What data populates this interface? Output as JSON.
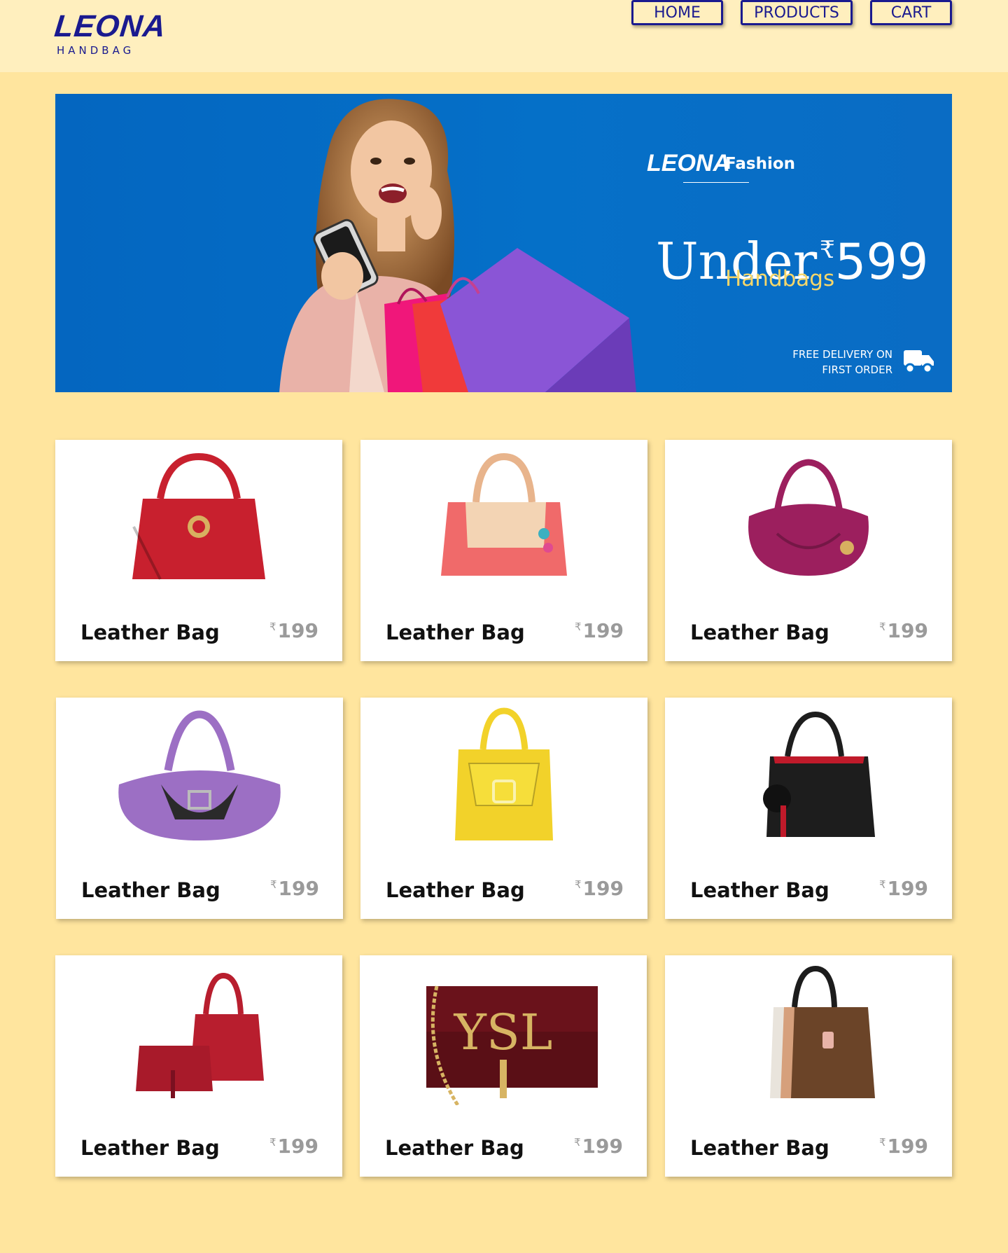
{
  "brand": {
    "name": "LEONA",
    "subtitle": "HANDBAG"
  },
  "nav": [
    {
      "label": "HOME"
    },
    {
      "label": "PRODUCTS"
    },
    {
      "label": "CART"
    }
  ],
  "banner": {
    "brand_mark": "LEONA",
    "brand_word": "Fashion",
    "headline": "Under",
    "currency": "₹",
    "price": "599",
    "subheadline": "Handbags",
    "delivery_line1": "FREE DELIVERY ON",
    "delivery_line2": "FIRST ORDER",
    "icon": "truck-icon"
  },
  "products": [
    {
      "name": "Leather Bag",
      "currency": "₹",
      "price": "199",
      "color": "#c8202e",
      "style": "tote"
    },
    {
      "name": "Leather Bag",
      "currency": "₹",
      "price": "199",
      "color": "#f06a6a",
      "style": "satchel"
    },
    {
      "name": "Leather Bag",
      "currency": "₹",
      "price": "199",
      "color": "#9c1f5e",
      "style": "hobo"
    },
    {
      "name": "Leather Bag",
      "currency": "₹",
      "price": "199",
      "color": "#9c6fc4",
      "style": "duffel"
    },
    {
      "name": "Leather Bag",
      "currency": "₹",
      "price": "199",
      "color": "#f2d22a",
      "style": "kelly"
    },
    {
      "name": "Leather Bag",
      "currency": "₹",
      "price": "199",
      "color": "#1d1d1d",
      "style": "bucket"
    },
    {
      "name": "Leather Bag",
      "currency": "₹",
      "price": "199",
      "color": "#b81e2e",
      "style": "set"
    },
    {
      "name": "Leather Bag",
      "currency": "₹",
      "price": "199",
      "color": "#5a0f16",
      "style": "clutch"
    },
    {
      "name": "Leather Bag",
      "currency": "₹",
      "price": "199",
      "color": "#6b4428",
      "style": "stack"
    }
  ],
  "colors": {
    "page_bg": "#ffe59e",
    "header_bg": "#ffefbe",
    "brand_blue": "#1a1a8f",
    "banner_blue": "#0570c8",
    "accent_yellow": "#f7d76a",
    "price_gray": "#9a9a9a"
  }
}
